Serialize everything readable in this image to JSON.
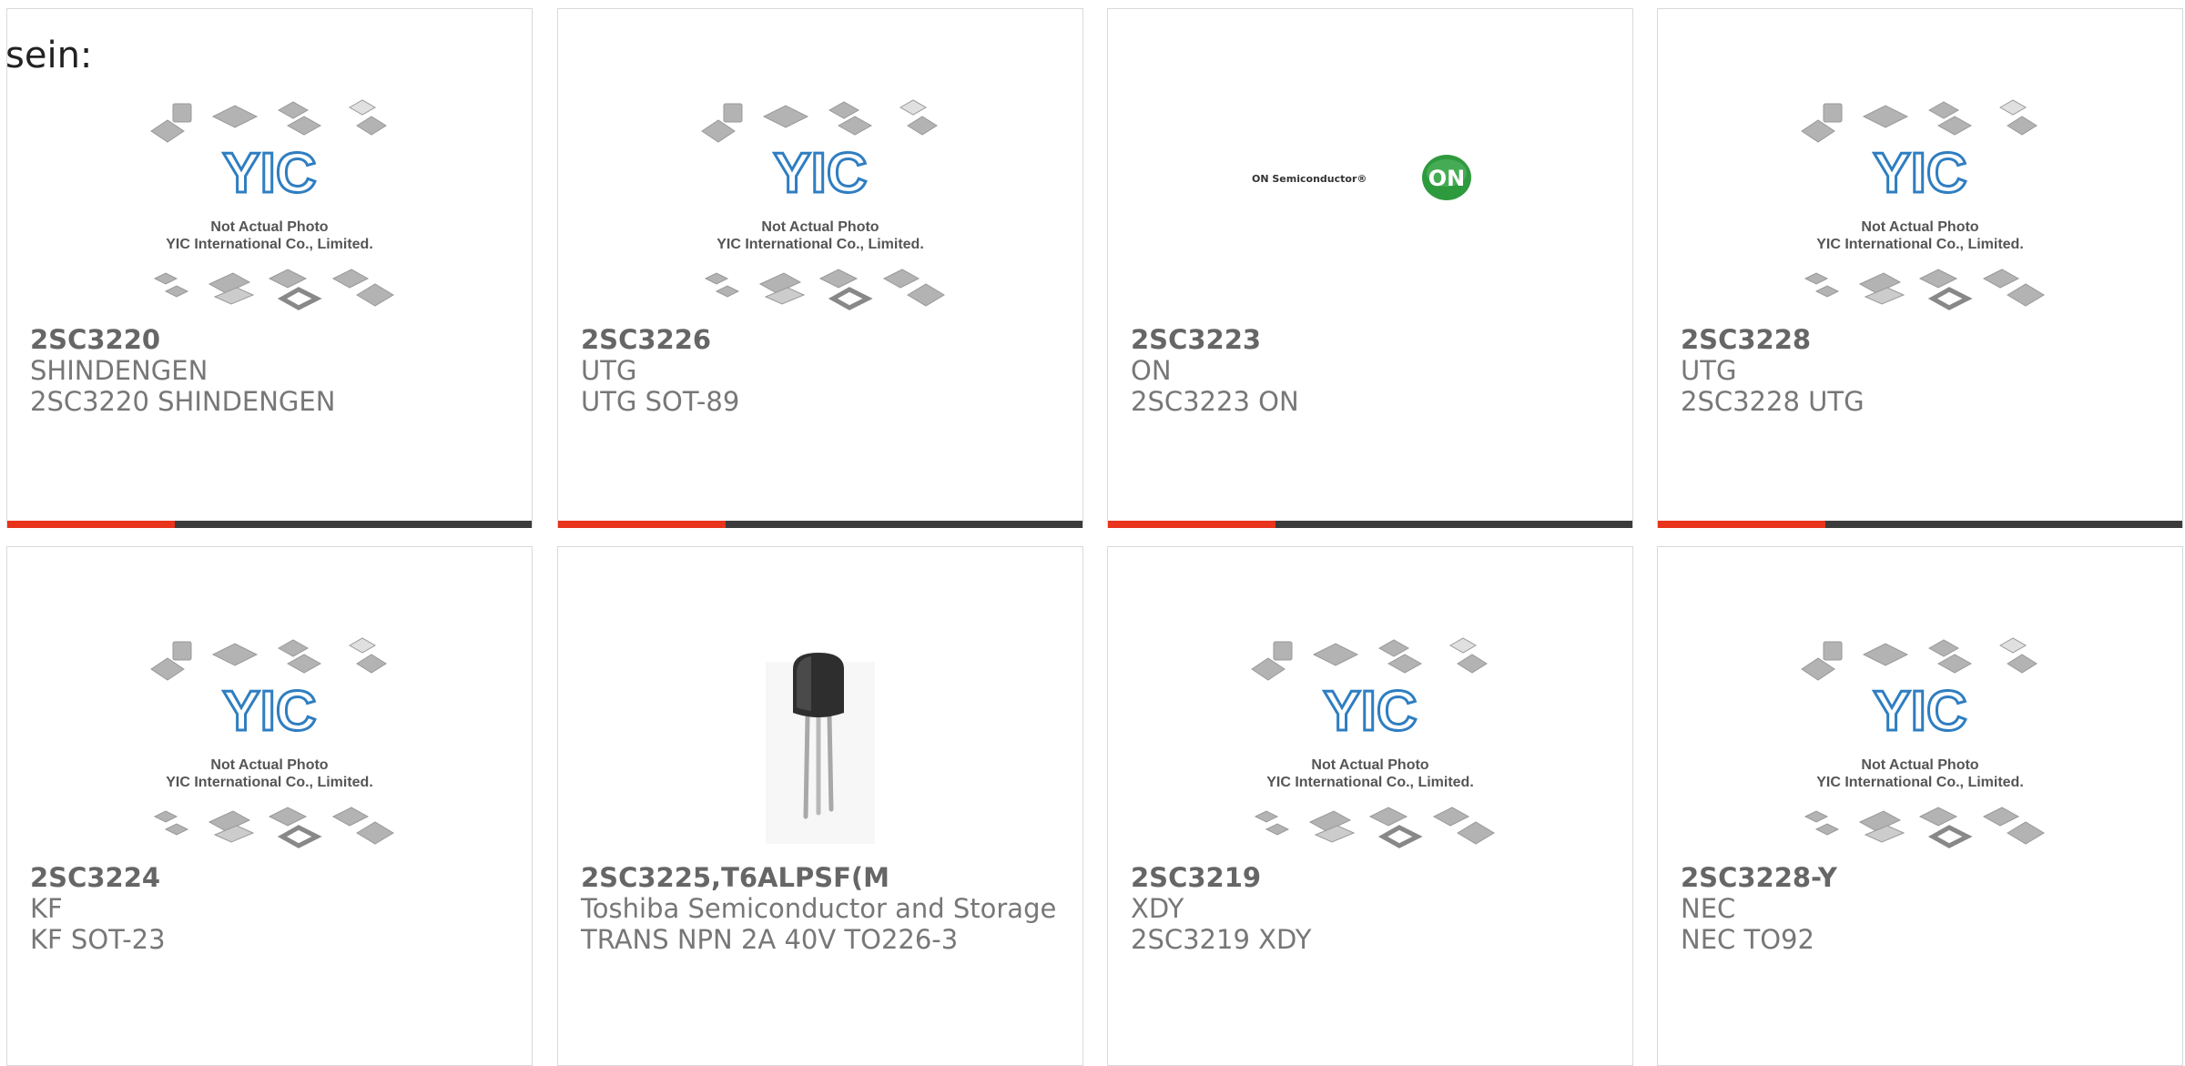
{
  "intro_text": "sein:",
  "colors": {
    "accent": "#e8341c",
    "track": "#3b3b3b",
    "yic_blue": "#2f7ec1",
    "on_green": "#2e9a3e"
  },
  "placeholder": {
    "line1": "Not Actual Photo",
    "line2": "YIC International Co., Limited.",
    "logo_letters": "YIC"
  },
  "on_logo": {
    "wordmark": "ON Semiconductor®",
    "badge": "ON"
  },
  "cards": [
    {
      "part": "2SC3220",
      "brand": "SHINDENGEN",
      "desc": "2SC3220 SHINDENGEN",
      "image": "yic-placeholder",
      "progress": 0.32
    },
    {
      "part": "2SC3226",
      "brand": "UTG",
      "desc": "UTG SOT-89",
      "image": "yic-placeholder",
      "progress": 0.32
    },
    {
      "part": "2SC3223",
      "brand": "ON",
      "desc": "2SC3223 ON",
      "image": "on-semiconductor-logo",
      "progress": 0.32
    },
    {
      "part": "2SC3228",
      "brand": "UTG",
      "desc": "2SC3228 UTG",
      "image": "yic-placeholder",
      "progress": 0.32
    },
    {
      "part": "2SC3224",
      "brand": "KF",
      "desc": "KF SOT-23",
      "image": "yic-placeholder"
    },
    {
      "part": "2SC3225,T6ALPSF(M",
      "brand": "Toshiba Semiconductor and Storage",
      "desc": "TRANS NPN 2A 40V TO226-3",
      "image": "transistor-photo"
    },
    {
      "part": "2SC3219",
      "brand": "XDY",
      "desc": "2SC3219 XDY",
      "image": "yic-placeholder"
    },
    {
      "part": "2SC3228-Y",
      "brand": "NEC",
      "desc": "NEC TO92",
      "image": "yic-placeholder"
    }
  ]
}
